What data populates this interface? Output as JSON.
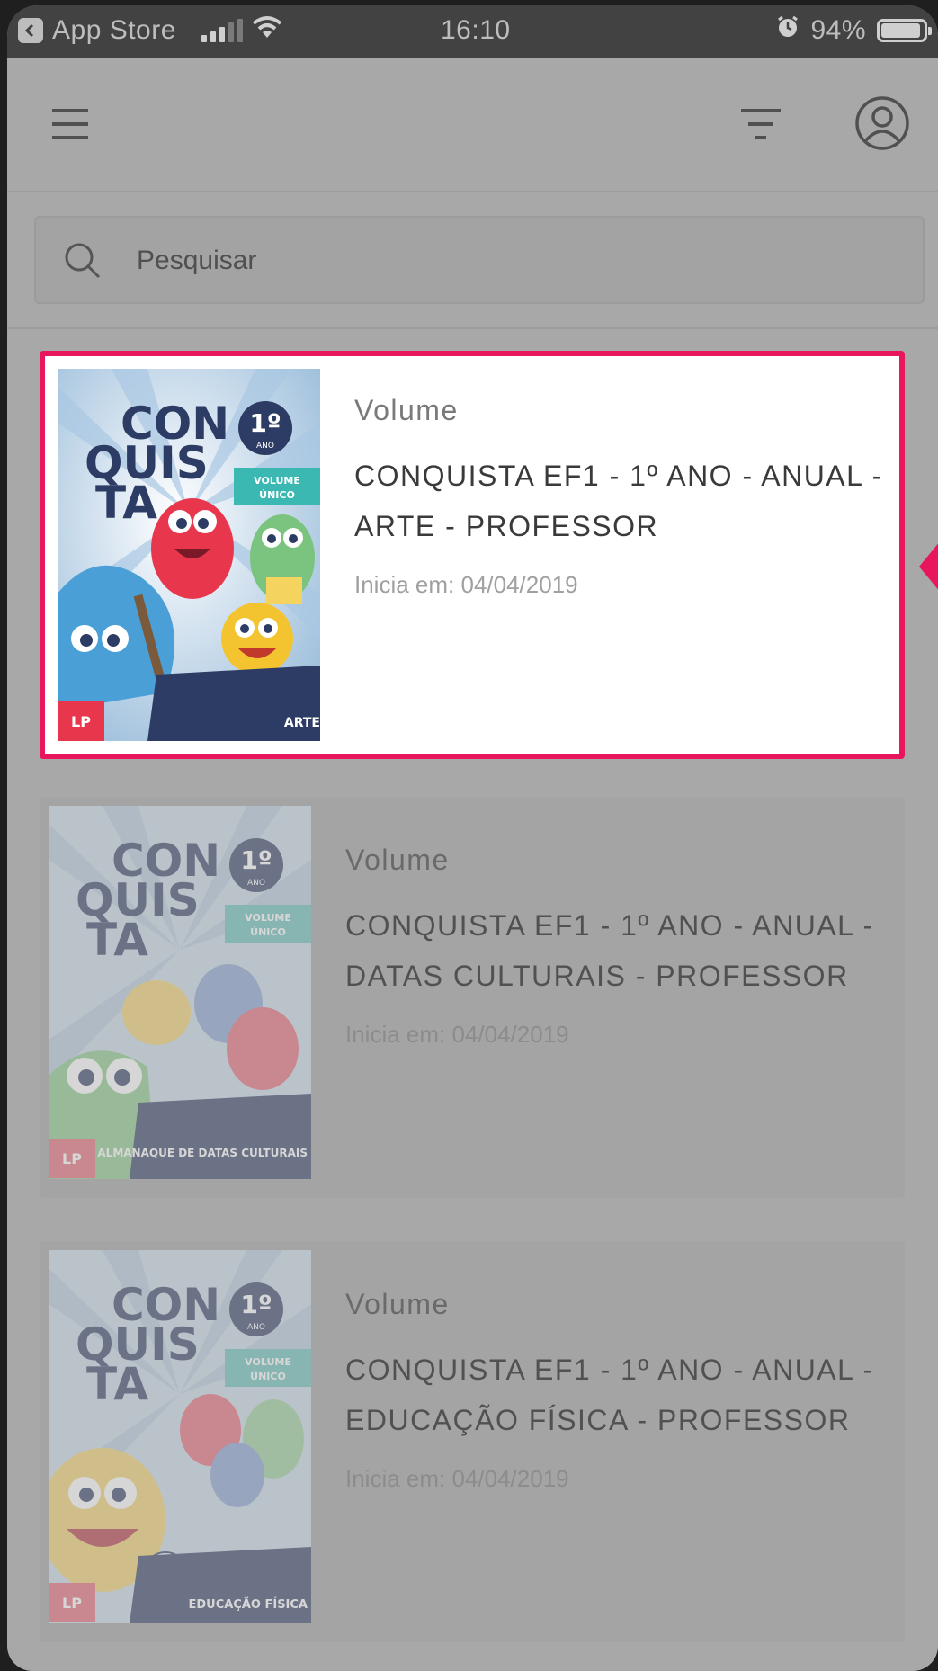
{
  "status_bar": {
    "back_app": "App Store",
    "time": "16:10",
    "battery": "94%"
  },
  "search": {
    "placeholder": "Pesquisar"
  },
  "items": [
    {
      "kind": "Volume",
      "title": "CONQUISTA EF1 - 1º ANO - ANUAL - ARTE - PROFESSOR",
      "date": "Inicia em: 04/04/2019",
      "cover": {
        "brand": "LP",
        "subject": "ARTE",
        "grade": "1º",
        "grade_label": "ANO",
        "tag": "VOLUME ÚNICO",
        "series": "CONQUISTA"
      },
      "highlighted": true
    },
    {
      "kind": "Volume",
      "title": "CONQUISTA EF1 - 1º ANO - ANUAL - DATAS CULTURAIS - PROFESSOR",
      "date": "Inicia em: 04/04/2019",
      "cover": {
        "brand": "LP",
        "subject": "ALMANAQUE DE DATAS CULTURAIS",
        "grade": "1º",
        "grade_label": "ANO",
        "tag": "VOLUME ÚNICO",
        "series": "CONQUISTA"
      },
      "highlighted": false
    },
    {
      "kind": "Volume",
      "title": "CONQUISTA EF1 - 1º ANO - ANUAL - EDUCAÇÃO FÍSICA - PROFESSOR",
      "date": "Inicia em: 04/04/2019",
      "cover": {
        "brand": "LP",
        "subject": "EDUCAÇÃO FÍSICA",
        "grade": "1º",
        "grade_label": "ANO",
        "tag": "VOLUME ÚNICO",
        "series": "CONQUISTA"
      },
      "highlighted": false
    }
  ],
  "colors": {
    "highlight": "#e8175d",
    "overlay": "#a8a8a8",
    "statusbar": "#424242"
  },
  "icons": [
    "chevron-left-icon",
    "signal-icon",
    "wifi-icon",
    "alarm-icon",
    "battery-icon",
    "menu-icon",
    "filter-icon",
    "profile-icon",
    "search-icon"
  ]
}
